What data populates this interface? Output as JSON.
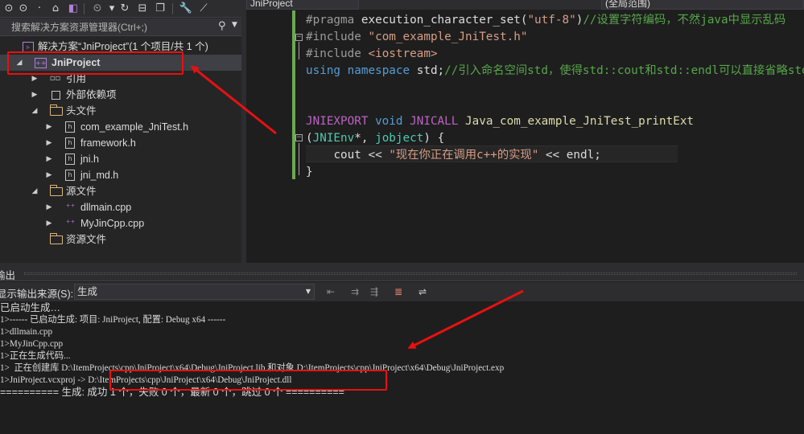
{
  "solution_explorer": {
    "search_placeholder": "搜索解决方案资源管理器(Ctrl+;)",
    "tree": [
      {
        "label": "解决方案“JniProject”(1 个项目/共 1 个)",
        "icon": "solution-icon"
      },
      {
        "label": "JniProject",
        "icon": "project-icon",
        "selected": true
      },
      {
        "label": "引用",
        "icon": "references-icon"
      },
      {
        "label": "外部依赖项",
        "icon": "external-deps-icon"
      },
      {
        "label": "头文件",
        "icon": "folder-icon"
      },
      {
        "label": "com_example_JniTest.h",
        "icon": "header-file-icon"
      },
      {
        "label": "framework.h",
        "icon": "header-file-icon"
      },
      {
        "label": "jni.h",
        "icon": "header-file-icon"
      },
      {
        "label": "jni_md.h",
        "icon": "header-file-icon"
      },
      {
        "label": "源文件",
        "icon": "folder-icon"
      },
      {
        "label": "dllmain.cpp",
        "icon": "cpp-file-icon"
      },
      {
        "label": "MyJinCpp.cpp",
        "icon": "cpp-file-icon"
      },
      {
        "label": "资源文件",
        "icon": "folder-icon"
      }
    ]
  },
  "editor": {
    "nav_project": "JniProject",
    "nav_scope": "(全局范围)",
    "code": [
      {
        "type": "pragma",
        "kw": "#pragma",
        "rest": " execution_character_set(",
        "str": "\"utf-8\"",
        "close": ")",
        "comment": "//设置字符编码，不然java中显示乱码"
      },
      {
        "type": "include",
        "kw": "#include",
        "str": " \"com_example_JniTest.h\""
      },
      {
        "type": "include",
        "kw": "#include",
        "str": " <iostream>"
      },
      {
        "type": "using",
        "kw1": "using",
        "kw2": " namespace",
        "rest": " std;",
        "comment": "//引入命名空间std，使得std::cout和std::endl可以直接省略std::"
      },
      {
        "type": "blank"
      },
      {
        "type": "blank"
      },
      {
        "type": "signature",
        "m1": "JNIEXPORT",
        "t1": " void",
        "m2": " JNICALL",
        "fn": " Java_com_example_JniTest_printExt"
      },
      {
        "type": "params",
        "open": "(",
        "type1": "JNIEnv",
        "rest": "*, ",
        "type2": "jobject",
        "close": ") {"
      },
      {
        "type": "cout",
        "indent": "    ",
        "a": "cout << ",
        "str": "\"现在你正在调用c++的实现\"",
        "b": " << endl;"
      },
      {
        "type": "brace",
        "text": "}"
      }
    ]
  },
  "output": {
    "title": "输出",
    "source_label": "显示输出来源(S):",
    "source_value": "生成",
    "lines": [
      "已启动生成…",
      "1>------ 已启动生成: 项目: JniProject, 配置: Debug x64 ------",
      "1>dllmain.cpp",
      "1>MyJinCpp.cpp",
      "1>正在生成代码...",
      "1>  正在创建库 D:\\ItemProjects\\cpp\\JniProject\\x64\\Debug\\JniProject.lib 和对象 D:\\ItemProjects\\cpp\\JniProject\\x64\\Debug\\JniProject.exp",
      "1>JniProject.vcxproj -> D:\\ItemProjects\\cpp\\JniProject\\x64\\Debug\\JniProject.dll",
      "========== 生成: 成功 1 个，失败 0 个，最新 0 个，跳过 0 个 =========="
    ]
  },
  "annotation_color": "#e8110f"
}
